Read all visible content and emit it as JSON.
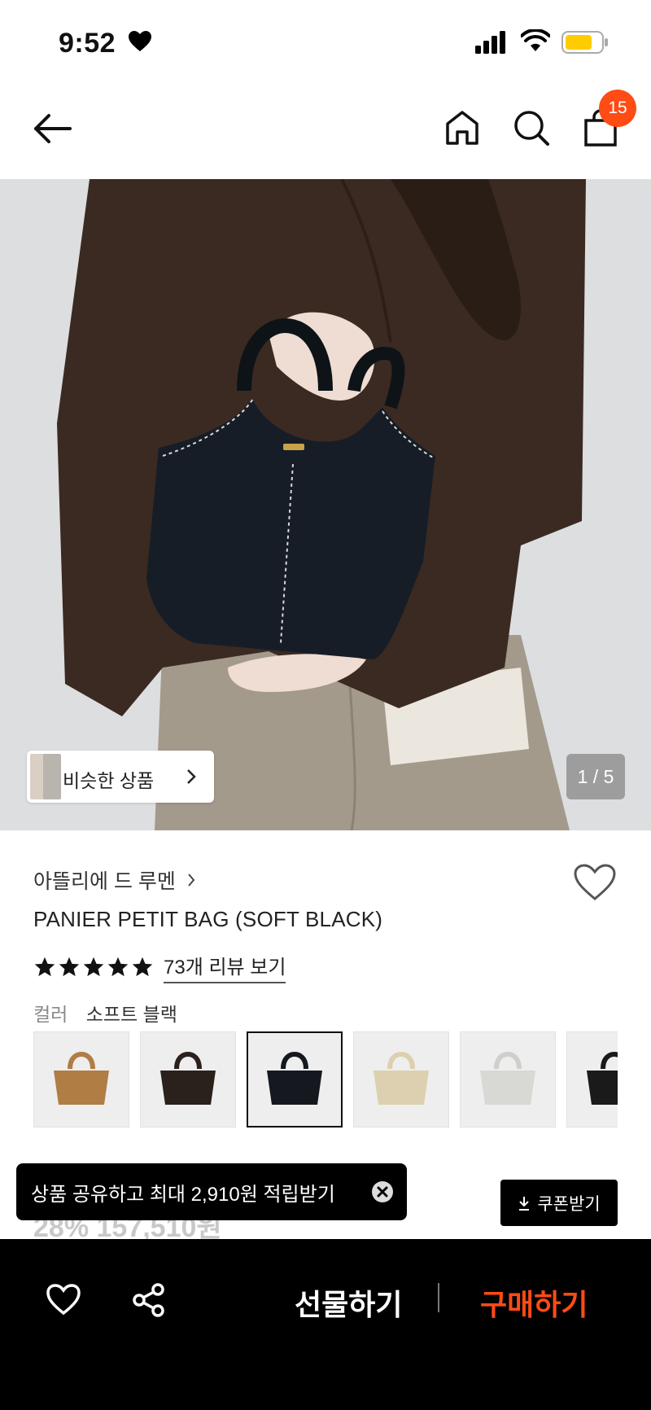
{
  "status": {
    "time": "9:52"
  },
  "header": {
    "cart_count": "15"
  },
  "hero": {
    "similar_label": "비슷한 상품",
    "pager": "1 / 5"
  },
  "product": {
    "brand": "아뜰리에 드 루멘",
    "name": "PANIER PETIT BAG (SOFT BLACK)",
    "rating_stars": 5,
    "review_link": "73개 리뷰 보기",
    "color_label": "컬러",
    "color_value": "소프트 블랙",
    "swatches": [
      {
        "color": "#b07d45"
      },
      {
        "color": "#2a201c"
      },
      {
        "color": "#15191f",
        "selected": true
      },
      {
        "color": "#dcd0b0"
      },
      {
        "color": "#d8d8d4"
      },
      {
        "color": "#1a1a1a"
      }
    ],
    "price_partial": "28% 157,510원"
  },
  "toast": {
    "text": "상품 공유하고 최대 2,910원 적립받기"
  },
  "coupon": {
    "label": "쿠폰받기"
  },
  "bottom": {
    "gift_label": "선물하기",
    "buy_label": "구매하기"
  },
  "colors": {
    "accent": "#ff4b14"
  }
}
